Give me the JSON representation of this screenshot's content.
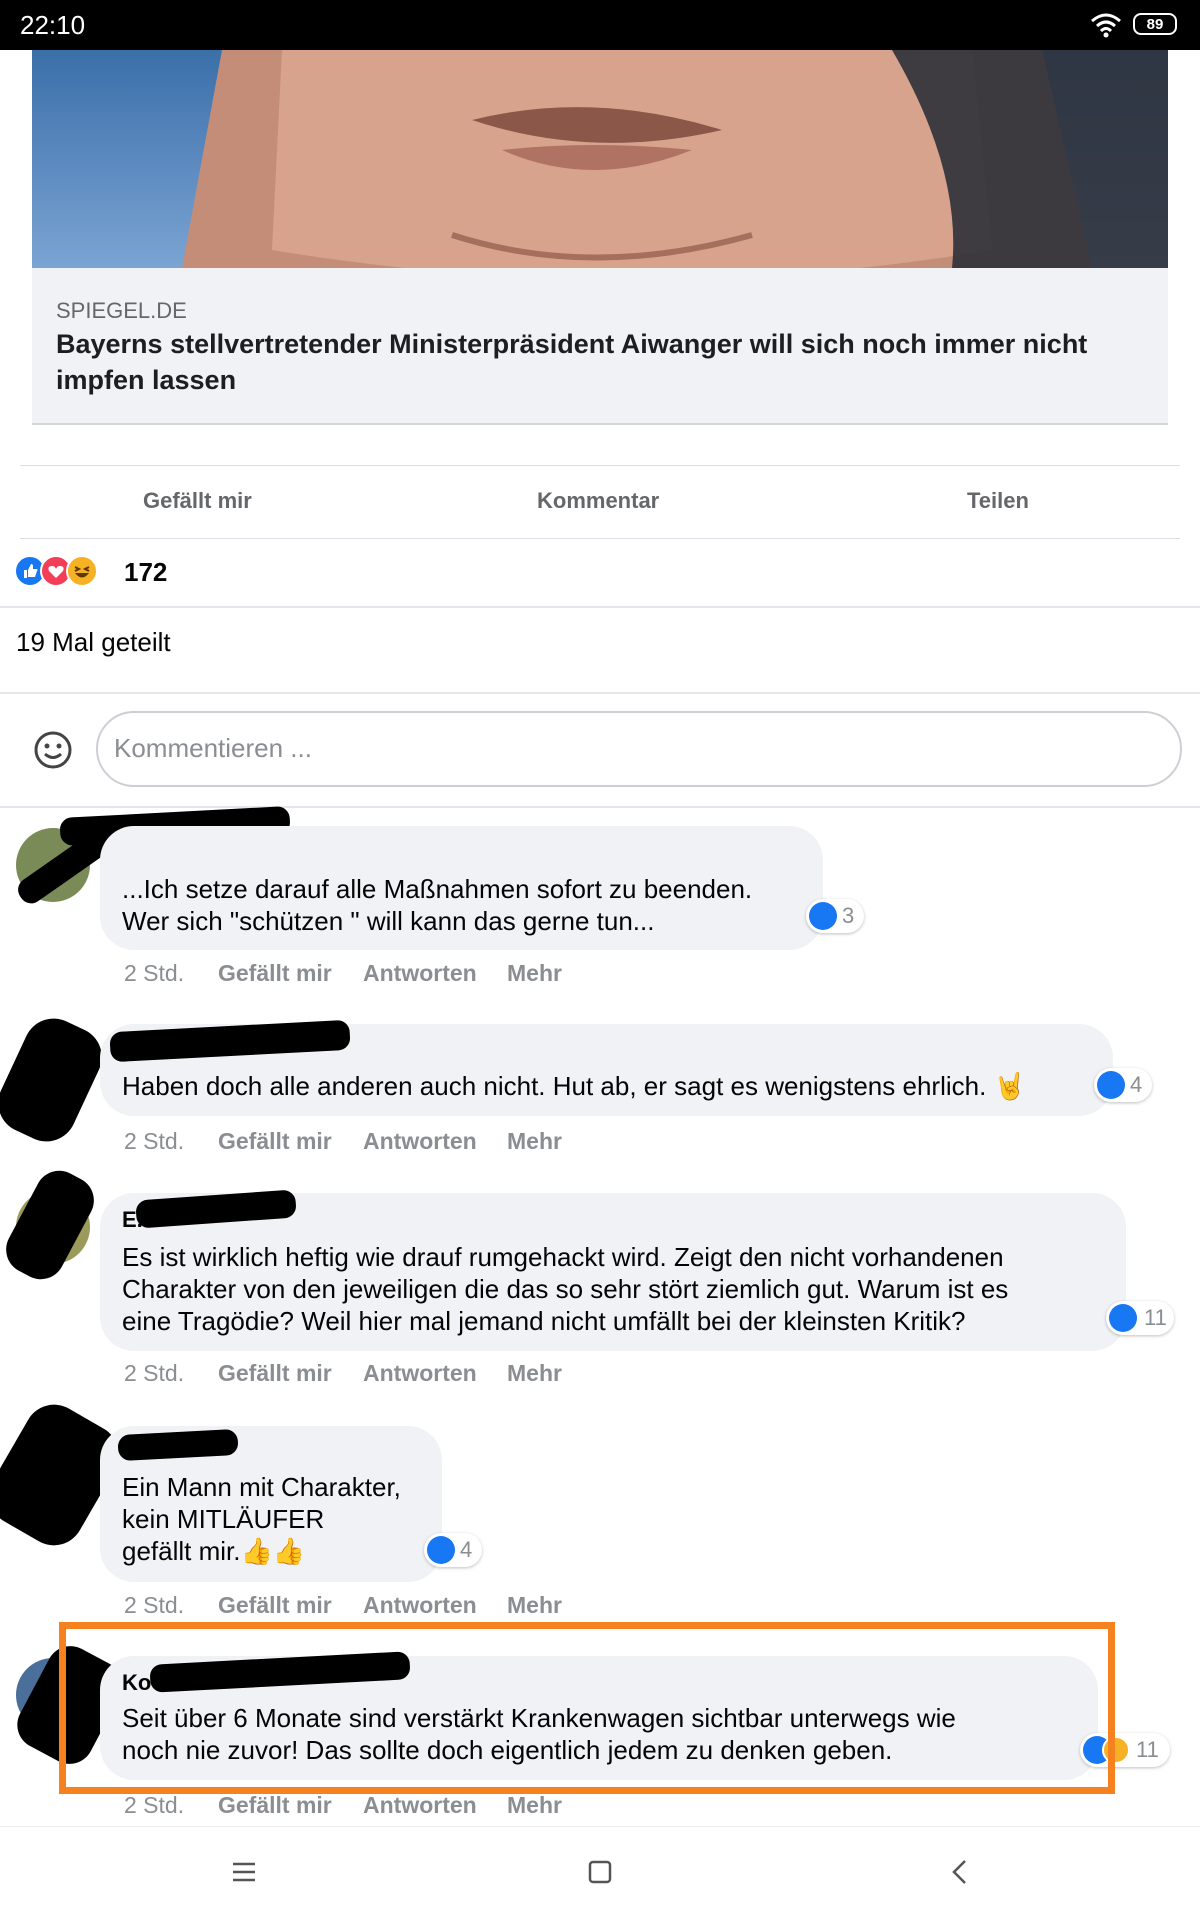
{
  "status_bar": {
    "time": "22:10",
    "battery": "89",
    "wifi_icon": "wifi-icon"
  },
  "link_preview": {
    "domain": "SPIEGEL.DE",
    "title": "Bayerns stellvertretender Ministerpräsident Aiwanger will sich noch immer nicht impfen lassen"
  },
  "actions": {
    "like": "Gefällt mir",
    "comment": "Kommentar",
    "share": "Teilen"
  },
  "reactions": {
    "count": "172",
    "icons": [
      "like-icon",
      "love-icon",
      "haha-icon"
    ]
  },
  "shares": "19 Mal geteilt",
  "composer": {
    "placeholder": "Kommentieren ..."
  },
  "comments": [
    {
      "name": "",
      "text": "...Ich setze darauf alle Maßnahmen sofort zu beenden.\nWer sich \"schützen \" will kann das gerne tun...",
      "reactions": "3",
      "time": "2 Std.",
      "like": "Gefällt mir",
      "reply": "Antworten",
      "more": "Mehr"
    },
    {
      "name": "",
      "text": "Haben doch alle anderen auch nicht. Hut ab, er sagt es wenigstens ehrlich. 🤘",
      "reactions": "4",
      "time": "2 Std.",
      "like": "Gefällt mir",
      "reply": "Antworten",
      "more": "Mehr"
    },
    {
      "name": "E...",
      "text": "Es ist wirklich heftig wie drauf rumgehackt wird. Zeigt den nicht vorhandenen\nCharakter von den jeweiligen die das so sehr stört ziemlich gut. Warum ist es\neine Tragödie? Weil hier mal jemand nicht umfällt bei der kleinsten Kritik?",
      "reactions": "11",
      "time": "2 Std.",
      "like": "Gefällt mir",
      "reply": "Antworten",
      "more": "Mehr"
    },
    {
      "name": "",
      "text": "Ein Mann mit Charakter,\nkein MITLÄUFER\ngefällt mir.👍👍",
      "reactions": "4",
      "time": "2 Std.",
      "like": "Gefällt mir",
      "reply": "Antworten",
      "more": "Mehr"
    },
    {
      "name": "Ko",
      "text": "Seit über 6 Monate sind verstärkt Krankenwagen sichtbar unterwegs wie\nnoch nie zuvor! Das sollte doch eigentlich jedem zu denken geben.",
      "reactions": "11",
      "time": "2 Std.",
      "like": "Gefällt mir",
      "reply": "Antworten",
      "more": "Mehr"
    }
  ],
  "colors": {
    "highlight": "#f5821f",
    "like_blue": "#1877f2",
    "bubble": "#f0f2f5"
  }
}
